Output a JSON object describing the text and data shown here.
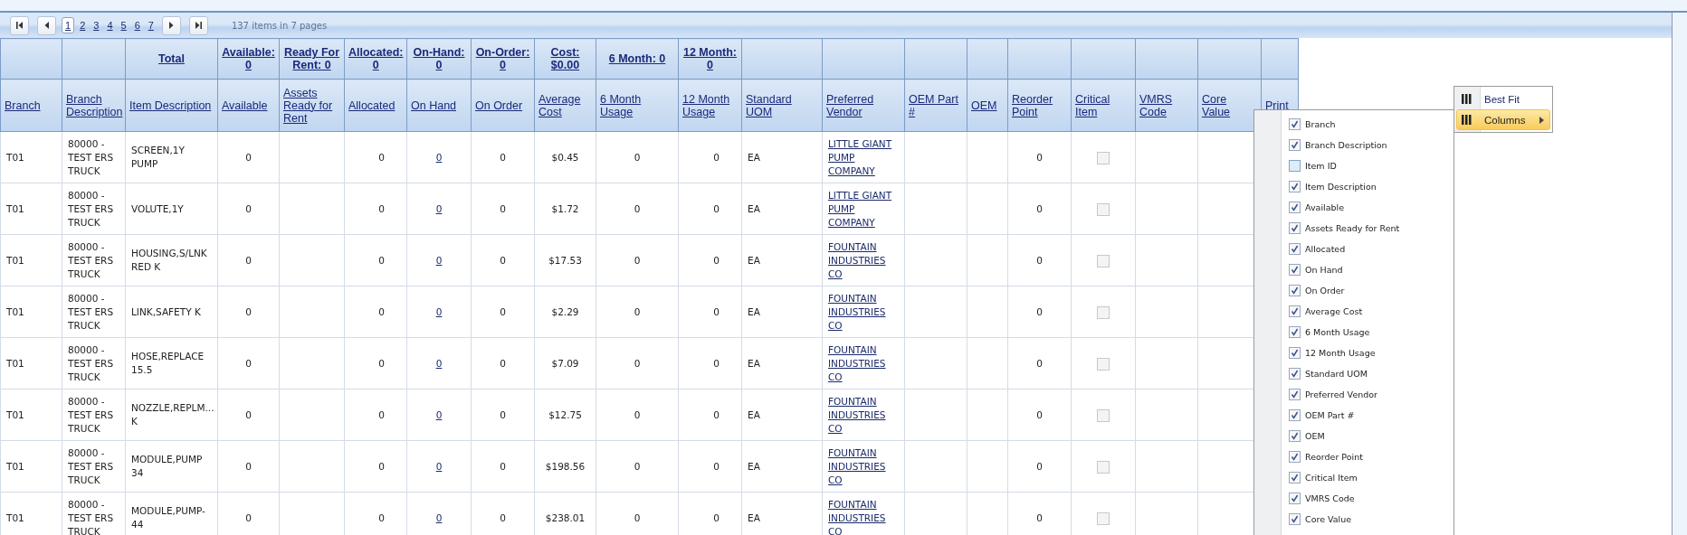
{
  "pager": {
    "pages": [
      {
        "label": "1",
        "selected": true
      },
      {
        "label": "2",
        "selected": false
      },
      {
        "label": "3",
        "selected": false
      },
      {
        "label": "4",
        "selected": false
      },
      {
        "label": "5",
        "selected": false
      },
      {
        "label": "6",
        "selected": false
      },
      {
        "label": "7",
        "selected": false
      }
    ],
    "summary": "137 items in 7 pages"
  },
  "table": {
    "columns": [
      {
        "label": "Branch"
      },
      {
        "label": "Branch Description"
      },
      {
        "label": "Item Description",
        "aggregate": "Total"
      },
      {
        "label": "Available",
        "aggregate": "Available: 0"
      },
      {
        "label": "Assets Ready for Rent",
        "aggregate": "Ready For Rent: 0"
      },
      {
        "label": "Allocated",
        "aggregate": "Allocated: 0"
      },
      {
        "label": "On Hand",
        "aggregate": "On-Hand: 0"
      },
      {
        "label": "On Order",
        "aggregate": "On-Order: 0"
      },
      {
        "label": "Average Cost",
        "aggregate": "Cost: $0.00"
      },
      {
        "label": "6 Month Usage",
        "aggregate": "6 Month: 0"
      },
      {
        "label": "12 Month Usage",
        "aggregate": "12 Month: 0"
      },
      {
        "label": "Standard UOM"
      },
      {
        "label": "Preferred Vendor"
      },
      {
        "label": "OEM Part #"
      },
      {
        "label": "OEM"
      },
      {
        "label": "Reorder Point"
      },
      {
        "label": "Critical Item"
      },
      {
        "label": "VMRS Code"
      },
      {
        "label": "Core Value"
      },
      {
        "label": "Print"
      }
    ],
    "rows": [
      {
        "branch": "T01",
        "branch_description": "80000 - TEST ERS TRUCK",
        "item_description": "SCREEN,1Y PUMP",
        "available": "0",
        "allocated": "0",
        "on_hand": "0",
        "on_order": "0",
        "average_cost": "$0.45",
        "six_month_usage": "0",
        "twelve_month_usage": "0",
        "standard_uom": "EA",
        "preferred_vendor": "LITTLE GIANT PUMP COMPANY",
        "reorder_point": "0",
        "critical_item": false
      },
      {
        "branch": "T01",
        "branch_description": "80000 - TEST ERS TRUCK",
        "item_description": "VOLUTE,1Y",
        "available": "0",
        "allocated": "0",
        "on_hand": "0",
        "on_order": "0",
        "average_cost": "$1.72",
        "six_month_usage": "0",
        "twelve_month_usage": "0",
        "standard_uom": "EA",
        "preferred_vendor": "LITTLE GIANT PUMP COMPANY",
        "reorder_point": "0",
        "critical_item": false
      },
      {
        "branch": "T01",
        "branch_description": "80000 - TEST ERS TRUCK",
        "item_description": "HOUSING,S/LNK RED K",
        "available": "0",
        "allocated": "0",
        "on_hand": "0",
        "on_order": "0",
        "average_cost": "$17.53",
        "six_month_usage": "0",
        "twelve_month_usage": "0",
        "standard_uom": "EA",
        "preferred_vendor": "FOUNTAIN INDUSTRIES CO",
        "reorder_point": "0",
        "critical_item": false
      },
      {
        "branch": "T01",
        "branch_description": "80000 - TEST ERS TRUCK",
        "item_description": "LINK,SAFETY K",
        "available": "0",
        "allocated": "0",
        "on_hand": "0",
        "on_order": "0",
        "average_cost": "$2.29",
        "six_month_usage": "0",
        "twelve_month_usage": "0",
        "standard_uom": "EA",
        "preferred_vendor": "FOUNTAIN INDUSTRIES CO",
        "reorder_point": "0",
        "critical_item": false
      },
      {
        "branch": "T01",
        "branch_description": "80000 - TEST ERS TRUCK",
        "item_description": "HOSE,REPLACE 15.5",
        "available": "0",
        "allocated": "0",
        "on_hand": "0",
        "on_order": "0",
        "average_cost": "$7.09",
        "six_month_usage": "0",
        "twelve_month_usage": "0",
        "standard_uom": "EA",
        "preferred_vendor": "FOUNTAIN INDUSTRIES CO",
        "reorder_point": "0",
        "critical_item": false
      },
      {
        "branch": "T01",
        "branch_description": "80000 - TEST ERS TRUCK",
        "item_description": "NOZZLE,REPLM... K",
        "available": "0",
        "allocated": "0",
        "on_hand": "0",
        "on_order": "0",
        "average_cost": "$12.75",
        "six_month_usage": "0",
        "twelve_month_usage": "0",
        "standard_uom": "EA",
        "preferred_vendor": "FOUNTAIN INDUSTRIES CO",
        "reorder_point": "0",
        "critical_item": false
      },
      {
        "branch": "T01",
        "branch_description": "80000 - TEST ERS TRUCK",
        "item_description": "MODULE,PUMP 34",
        "available": "0",
        "allocated": "0",
        "on_hand": "0",
        "on_order": "0",
        "average_cost": "$198.56",
        "six_month_usage": "0",
        "twelve_month_usage": "0",
        "standard_uom": "EA",
        "preferred_vendor": "FOUNTAIN INDUSTRIES CO",
        "reorder_point": "0",
        "critical_item": false
      },
      {
        "branch": "T01",
        "branch_description": "80000 - TEST ERS TRUCK",
        "item_description": "MODULE,PUMP-44",
        "available": "0",
        "allocated": "0",
        "on_hand": "0",
        "on_order": "0",
        "average_cost": "$238.01",
        "six_month_usage": "0",
        "twelve_month_usage": "0",
        "standard_uom": "EA",
        "preferred_vendor": "FOUNTAIN INDUSTRIES CO",
        "reorder_point": "0",
        "critical_item": false
      }
    ]
  },
  "context_menu": {
    "items": [
      {
        "label": "Best Fit",
        "highlighted": false,
        "has_submenu": false
      },
      {
        "label": "Columns",
        "highlighted": true,
        "has_submenu": true
      }
    ]
  },
  "columns_submenu": {
    "items": [
      {
        "label": "Branch",
        "checked": true
      },
      {
        "label": "Branch Description",
        "checked": true
      },
      {
        "label": "Item ID",
        "checked": false
      },
      {
        "label": "Item Description",
        "checked": true
      },
      {
        "label": "Available",
        "checked": true
      },
      {
        "label": "Assets Ready for Rent",
        "checked": true
      },
      {
        "label": "Allocated",
        "checked": true
      },
      {
        "label": "On Hand",
        "checked": true
      },
      {
        "label": "On Order",
        "checked": true
      },
      {
        "label": "Average Cost",
        "checked": true
      },
      {
        "label": "6 Month Usage",
        "checked": true
      },
      {
        "label": "12 Month Usage",
        "checked": true
      },
      {
        "label": "Standard UOM",
        "checked": true
      },
      {
        "label": "Preferred Vendor",
        "checked": true
      },
      {
        "label": "OEM Part #",
        "checked": true
      },
      {
        "label": "OEM",
        "checked": true
      },
      {
        "label": "Reorder Point",
        "checked": true
      },
      {
        "label": "Critical Item",
        "checked": true
      },
      {
        "label": "VMRS Code",
        "checked": true
      },
      {
        "label": "Core Value",
        "checked": true
      }
    ]
  }
}
